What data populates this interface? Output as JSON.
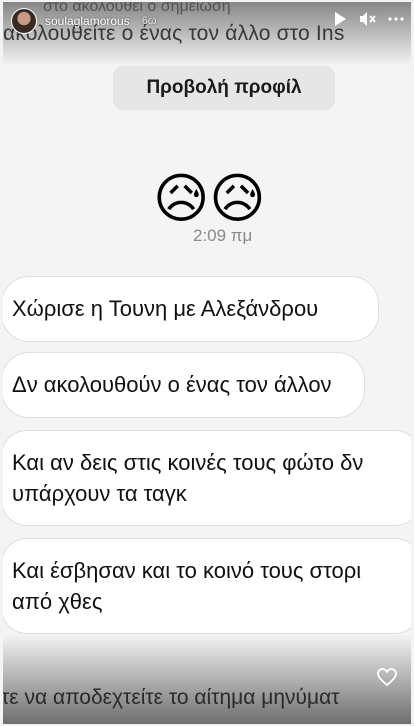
{
  "story": {
    "username": "soulaglamorous",
    "time_ago": "6ω",
    "bg_top_line0": "στο ακολουθεί ο σημείωση",
    "bg_top_line1": "ακολουθείτε ο ένας τον άλλο στο Ins",
    "bg_bottom_line": "τε να αποδεχτείτε το αίτημα μηνύματ"
  },
  "chat": {
    "profile_button": "Προβολή προφίλ",
    "emojis": "😥😥",
    "message_time": "2:09 πμ",
    "messages": [
      {
        "lines": [
          "Χώρισε η Τουνη με Αλεξάνδρου"
        ]
      },
      {
        "lines": [
          "Δν ακολουθούν ο ένας τον άλλον"
        ]
      },
      {
        "lines": [
          "Και αν δεις στις κοινές τους φώτο δν",
          "υπάρχουν τα ταγκ"
        ]
      },
      {
        "lines": [
          "Και έσβησαν και το κοινό τους στορι",
          "από χθες"
        ]
      }
    ]
  },
  "icons": {
    "play": "play-icon",
    "mute": "mute-icon",
    "more": "more-icon",
    "heart": "heart-icon"
  }
}
